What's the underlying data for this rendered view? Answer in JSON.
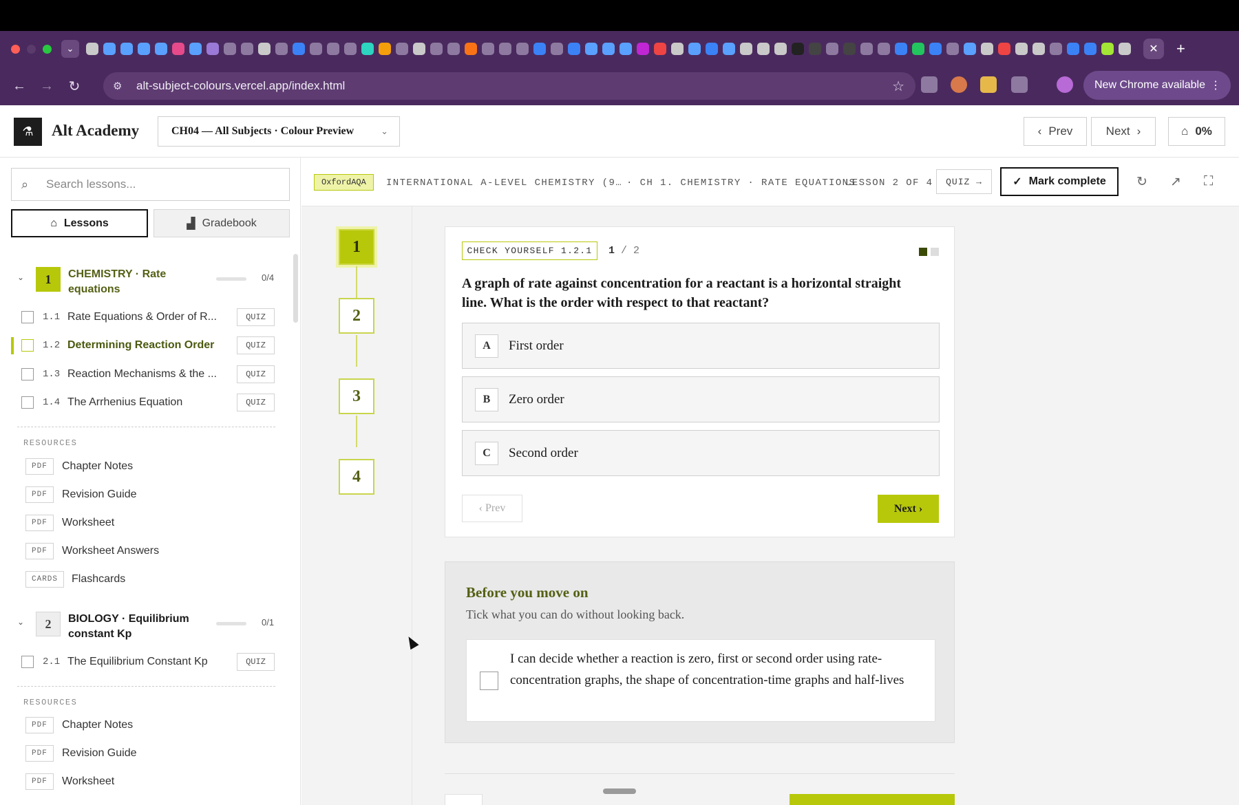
{
  "browser": {
    "url": "alt-subject-colours.vercel.app/index.html",
    "new_chrome_label": "New Chrome available",
    "tab_close": "✕",
    "new_tab": "+"
  },
  "app": {
    "brand": "Alt Academy",
    "chapter_select": "CH04 — All Subjects · Colour Preview",
    "prev_label": "Prev",
    "next_label": "Next",
    "progress": "0%"
  },
  "sidebar": {
    "search_placeholder": "Search lessons...",
    "tab_lessons": "Lessons",
    "tab_gradebook": "Gradebook",
    "resources_label": "RESOURCES",
    "sections": [
      {
        "number": "1",
        "title": "CHEMISTRY · Rate equations",
        "count": "0/4",
        "lessons": [
          {
            "code": "1.1",
            "label": "Rate Equations & Order of R...",
            "tag": "QUIZ"
          },
          {
            "code": "1.2",
            "label": "Determining Reaction Order",
            "tag": "QUIZ"
          },
          {
            "code": "1.3",
            "label": "Reaction Mechanisms & the ...",
            "tag": "QUIZ"
          },
          {
            "code": "1.4",
            "label": "The Arrhenius Equation",
            "tag": "QUIZ"
          }
        ],
        "resources": [
          {
            "tag": "PDF",
            "label": "Chapter Notes"
          },
          {
            "tag": "PDF",
            "label": "Revision Guide"
          },
          {
            "tag": "PDF",
            "label": "Worksheet"
          },
          {
            "tag": "PDF",
            "label": "Worksheet Answers"
          },
          {
            "tag": "CARDS",
            "label": "Flashcards"
          }
        ]
      },
      {
        "number": "2",
        "title": "BIOLOGY · Equilibrium constant Kp",
        "count": "0/1",
        "lessons": [
          {
            "code": "2.1",
            "label": "The Equilibrium Constant Kp",
            "tag": "QUIZ"
          }
        ],
        "resources": [
          {
            "tag": "PDF",
            "label": "Chapter Notes"
          },
          {
            "tag": "PDF",
            "label": "Revision Guide"
          },
          {
            "tag": "PDF",
            "label": "Worksheet"
          }
        ]
      }
    ]
  },
  "breadcrumb": {
    "board": "OxfordAQA",
    "course": "INTERNATIONAL A-LEVEL CHEMISTRY (9…",
    "chapter": "· CH 1. CHEMISTRY · RATE EQUATIONS",
    "lesson_pos": "LESSON 2 OF 4",
    "quiz_link": "QUIZ →",
    "mark_complete": "Mark complete"
  },
  "steps": [
    "1",
    "2",
    "3",
    "4"
  ],
  "quiz": {
    "tag": "CHECK YOURSELF 1.2.1",
    "current": "1",
    "total": "/ 2",
    "question": "A graph of rate against concentration for a reactant is a horizontal straight line. What is the order with respect to that reactant?",
    "options": [
      {
        "letter": "A",
        "text": "First order"
      },
      {
        "letter": "B",
        "text": "Zero order"
      },
      {
        "letter": "C",
        "text": "Second order"
      }
    ],
    "prev": "‹ Prev",
    "next": "Next ›"
  },
  "checklist": {
    "title": "Before you move on",
    "subtitle": "Tick what you can do without looking back.",
    "item": "I can decide whether a reaction is zero, first or second order using rate-concentration graphs, the shape of concentration-time graphs and half-lives"
  },
  "colors": {
    "accent": "#b7c80a",
    "accent_light": "#eef3a8",
    "accent_dark": "#556014",
    "chrome": "#4a2a5e"
  }
}
